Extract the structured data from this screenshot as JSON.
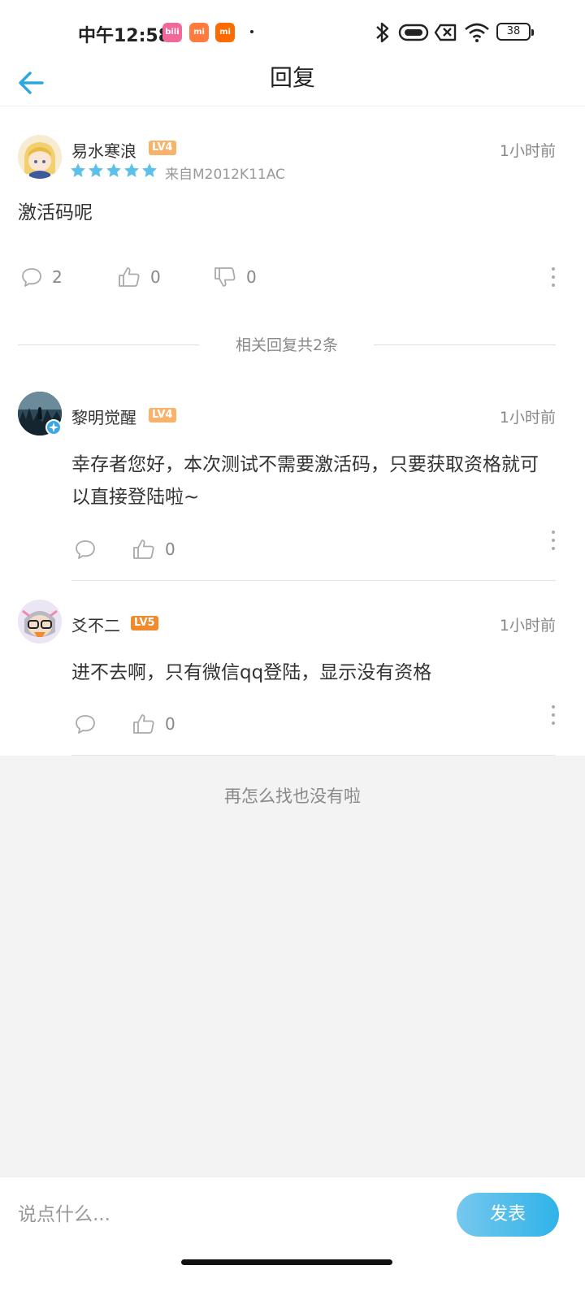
{
  "status_bar": {
    "time": "中午12:58",
    "apps": [
      {
        "name": "bilibili-app-icon",
        "label": "bili",
        "color": "#f0699a"
      },
      {
        "name": "mi-store-app-icon",
        "label": "mi",
        "color": "#ff7a3d"
      },
      {
        "name": "mi-app-icon",
        "label": "mi",
        "color": "#ff6a00"
      }
    ],
    "battery": "38"
  },
  "header": {
    "title": "回复"
  },
  "post": {
    "username": "易水寒浪",
    "level": "LV4",
    "level_color": "#f7b36b",
    "time": "1小时前",
    "stars": 5,
    "device": "来自M2012K11AC",
    "content": "激活码呢",
    "comments": "2",
    "likes": "0",
    "dislikes": "0"
  },
  "divider": {
    "text": "相关回复共2条"
  },
  "replies": [
    {
      "username": "黎明觉醒",
      "level": "LV4",
      "level_color": "#f7b36b",
      "time": "1小时前",
      "content": "幸存者您好，本次测试不需要激活码，只要获取资格就可以直接登陆啦~",
      "likes": "0"
    },
    {
      "username": "爻不二",
      "level": "LV5",
      "level_color": "#f08a2a",
      "time": "1小时前",
      "content": "进不去啊，只有微信qq登陆，显示没有资格",
      "likes": "0"
    }
  ],
  "end_text": "再怎么找也没有啦",
  "composer": {
    "placeholder": "说点什么...",
    "send_label": "发表"
  }
}
